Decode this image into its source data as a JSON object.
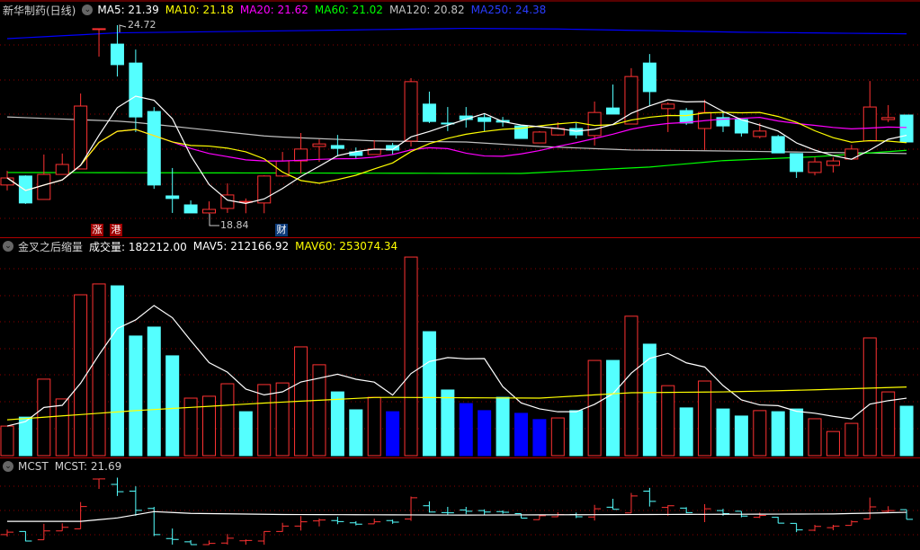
{
  "header": {
    "stock_title": "新华制药(日线)",
    "ma_labels": [
      {
        "text": "MA5: 21.39",
        "color": "#ffffff"
      },
      {
        "text": "MA10: 21.18",
        "color": "#ffff00"
      },
      {
        "text": "MA20: 21.62",
        "color": "#ff00ff"
      },
      {
        "text": "MA60: 21.02",
        "color": "#00ff00"
      },
      {
        "text": "MA120: 20.82",
        "color": "#c0c0c0"
      },
      {
        "text": "MA250: 24.38",
        "color": "#2a3cff"
      }
    ]
  },
  "price_annotations": {
    "high": "24.72",
    "low": "18.84"
  },
  "markers": [
    {
      "text": "涨",
      "bg": "#a00000"
    },
    {
      "text": "港",
      "bg": "#a00000"
    },
    {
      "text": "财",
      "bg": "#0a3a7a"
    }
  ],
  "volume_panel": {
    "indicator_name": "金叉之后缩量",
    "vol_label": "成交量: 182212.00",
    "mav5_label": "MAV5: 212166.92",
    "mav60_label": "MAV60: 253074.34"
  },
  "mcst_panel": {
    "indicator_name": "MCST",
    "mcst_label": "MCST: 21.69"
  },
  "colors": {
    "up": "#ff3232",
    "down": "#54ffff",
    "shrink": "#0000ff",
    "grid": "#8b0000"
  },
  "chart_data": {
    "type": "candlestick",
    "ohlc": [
      [
        19.74,
        19.96,
        20.18,
        19.57
      ],
      [
        20.02,
        19.18,
        20.04,
        19.15
      ],
      [
        19.29,
        20.07,
        20.69,
        19.29
      ],
      [
        20.07,
        20.38,
        20.72,
        20.07
      ],
      [
        20.24,
        22.2,
        22.59,
        20.24
      ],
      [
        24.6,
        24.61,
        24.61,
        23.74
      ],
      [
        24.13,
        23.49,
        24.72,
        23.12
      ],
      [
        23.54,
        21.86,
        23.96,
        21.39
      ],
      [
        22.03,
        19.74,
        22.17,
        19.62
      ],
      [
        19.4,
        19.32,
        20.27,
        18.87
      ],
      [
        19.12,
        18.87,
        19.26,
        18.9
      ],
      [
        18.87,
        18.98,
        19.23,
        18.84
      ],
      [
        19.01,
        19.43,
        19.79,
        18.87
      ],
      [
        19.2,
        19.23,
        19.32,
        18.86
      ],
      [
        19.18,
        20.02,
        20.04,
        18.86
      ],
      [
        20.02,
        20.49,
        20.77,
        19.99
      ],
      [
        20.49,
        20.86,
        21.36,
        20.1
      ],
      [
        20.94,
        21.02,
        21.16,
        20.46
      ],
      [
        20.97,
        20.88,
        21.3,
        20.66
      ],
      [
        20.77,
        20.66,
        20.91,
        20.55
      ],
      [
        20.69,
        20.86,
        21.14,
        20.69
      ],
      [
        20.97,
        20.83,
        21.05,
        20.69
      ],
      [
        21.11,
        22.96,
        23.07,
        20.94
      ],
      [
        22.26,
        21.72,
        22.65,
        21.67
      ],
      [
        21.67,
        21.65,
        22.17,
        21.42
      ],
      [
        21.89,
        21.78,
        22.17,
        21.53
      ],
      [
        21.84,
        21.72,
        21.95,
        21.42
      ],
      [
        21.75,
        21.7,
        21.86,
        21.56
      ],
      [
        21.58,
        21.19,
        21.58,
        21.19
      ],
      [
        21.05,
        21.39,
        21.42,
        21.05
      ],
      [
        21.3,
        21.5,
        21.7,
        21.28
      ],
      [
        21.5,
        21.3,
        21.67,
        21.19
      ],
      [
        21.28,
        22.0,
        22.34,
        20.97
      ],
      [
        22.14,
        21.95,
        22.87,
        21.95
      ],
      [
        21.64,
        23.12,
        23.38,
        21.64
      ],
      [
        23.54,
        22.65,
        23.82,
        22.2
      ],
      [
        22.12,
        22.26,
        22.31,
        21.39
      ],
      [
        22.06,
        21.67,
        22.14,
        21.61
      ],
      [
        21.5,
        22.0,
        22.4,
        20.83
      ],
      [
        21.84,
        21.58,
        22.0,
        21.39
      ],
      [
        21.78,
        21.36,
        21.78,
        21.25
      ],
      [
        21.25,
        21.42,
        21.67,
        21.19
      ],
      [
        21.25,
        20.74,
        21.3,
        20.74
      ],
      [
        20.72,
        20.16,
        20.72,
        19.96
      ],
      [
        20.13,
        20.46,
        20.6,
        20.04
      ],
      [
        20.35,
        20.49,
        20.6,
        20.13
      ],
      [
        20.55,
        20.86,
        20.99,
        20.55
      ],
      [
        21.11,
        22.17,
        22.98,
        21.11
      ],
      [
        21.78,
        21.84,
        22.23,
        21.7
      ],
      [
        21.92,
        21.08,
        21.92,
        21.08
      ]
    ],
    "ma60": [
      [
        0,
        20.13
      ],
      [
        28,
        20.1
      ],
      [
        35,
        20.3
      ],
      [
        39,
        20.5
      ],
      [
        44,
        20.62
      ],
      [
        49,
        20.82
      ]
    ],
    "ma120": [
      [
        0,
        21.86
      ],
      [
        6.5,
        21.72
      ],
      [
        14.3,
        21.25
      ],
      [
        20.2,
        21.11
      ],
      [
        25,
        21.08
      ],
      [
        29,
        20.94
      ],
      [
        34,
        20.83
      ],
      [
        39,
        20.8
      ],
      [
        49,
        20.72
      ]
    ],
    "ma250": [
      [
        0,
        24.3
      ],
      [
        6,
        24.48
      ],
      [
        16,
        24.55
      ],
      [
        25,
        24.62
      ],
      [
        30,
        24.6
      ],
      [
        40,
        24.5
      ],
      [
        49,
        24.45
      ]
    ],
    "volume": [
      109000,
      142000,
      282000,
      209000,
      593000,
      633000,
      626000,
      441000,
      474000,
      368000,
      212000,
      219000,
      265000,
      162000,
      262000,
      268000,
      401000,
      335000,
      235000,
      169000,
      215000,
      162000,
      732000,
      457000,
      242000,
      192000,
      166000,
      215000,
      156000,
      133000,
      139000,
      166000,
      351000,
      351000,
      514000,
      411000,
      258000,
      176000,
      275000,
      172000,
      146000,
      166000,
      162000,
      172000,
      136000,
      89000,
      119000,
      434000,
      235000,
      182212
    ],
    "volume_colors": "rcrrrrccccrrrcrrrrccrbrccbbcbbrcrcrcrcrccrccrrrrrc",
    "mav60": [
      [
        0,
        132000
      ],
      [
        7,
        166000
      ],
      [
        14.3,
        195000
      ],
      [
        20.2,
        215000
      ],
      [
        29,
        212000
      ],
      [
        34,
        232000
      ],
      [
        39,
        235000
      ],
      [
        43.7,
        242000
      ],
      [
        49,
        253074
      ]
    ],
    "mcst": [
      [
        0,
        20.9
      ],
      [
        4,
        20.9
      ],
      [
        6,
        21.2
      ],
      [
        8,
        21.75
      ],
      [
        10,
        21.6
      ],
      [
        15,
        21.5
      ],
      [
        25,
        21.45
      ],
      [
        35,
        21.5
      ],
      [
        45,
        21.55
      ],
      [
        49,
        21.69
      ]
    ]
  }
}
